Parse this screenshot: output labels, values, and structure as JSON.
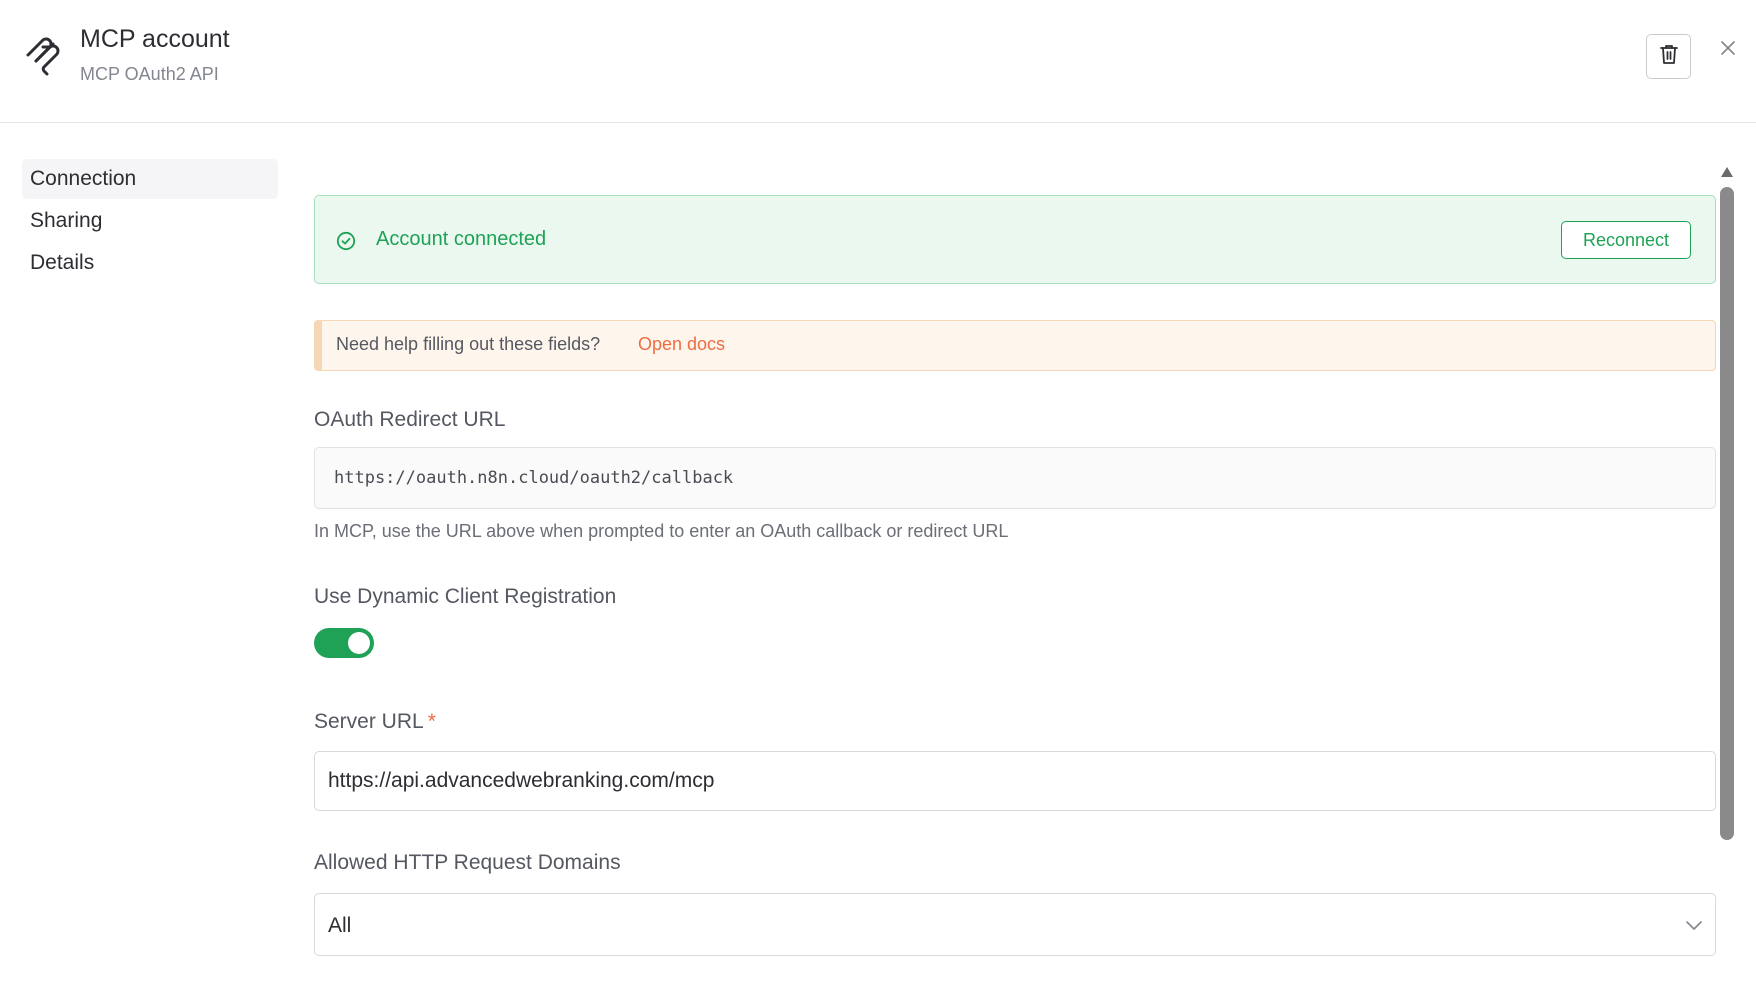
{
  "header": {
    "title": "MCP account",
    "subtitle": "MCP OAuth2 API",
    "icons": {
      "credential": "mcp-logo-icon",
      "delete": "trash-icon",
      "close": "close-icon"
    }
  },
  "sidebar": {
    "items": [
      {
        "label": "Connection",
        "active": true
      },
      {
        "label": "Sharing",
        "active": false
      },
      {
        "label": "Details",
        "active": false
      }
    ]
  },
  "connection": {
    "status_text": "Account connected",
    "reconnect_label": "Reconnect",
    "help_text": "Need help filling out these fields?",
    "help_link": "Open docs",
    "oauth_redirect": {
      "label": "OAuth Redirect URL",
      "value": "https://oauth.n8n.cloud/oauth2/callback",
      "hint": "In MCP, use the URL above when prompted to enter an OAuth callback or redirect URL"
    },
    "dynamic_registration": {
      "label": "Use Dynamic Client Registration",
      "enabled": true
    },
    "server_url": {
      "label": "Server URL",
      "required_mark": "*",
      "value": "https://api.advancedwebranking.com/mcp"
    },
    "allowed_domains": {
      "label": "Allowed HTTP Request Domains",
      "selected": "All"
    }
  },
  "colors": {
    "success": "#1fa256",
    "success_bg": "#eaf8ef",
    "warning_bg": "#fef5ec",
    "link": "#ee6d42"
  }
}
